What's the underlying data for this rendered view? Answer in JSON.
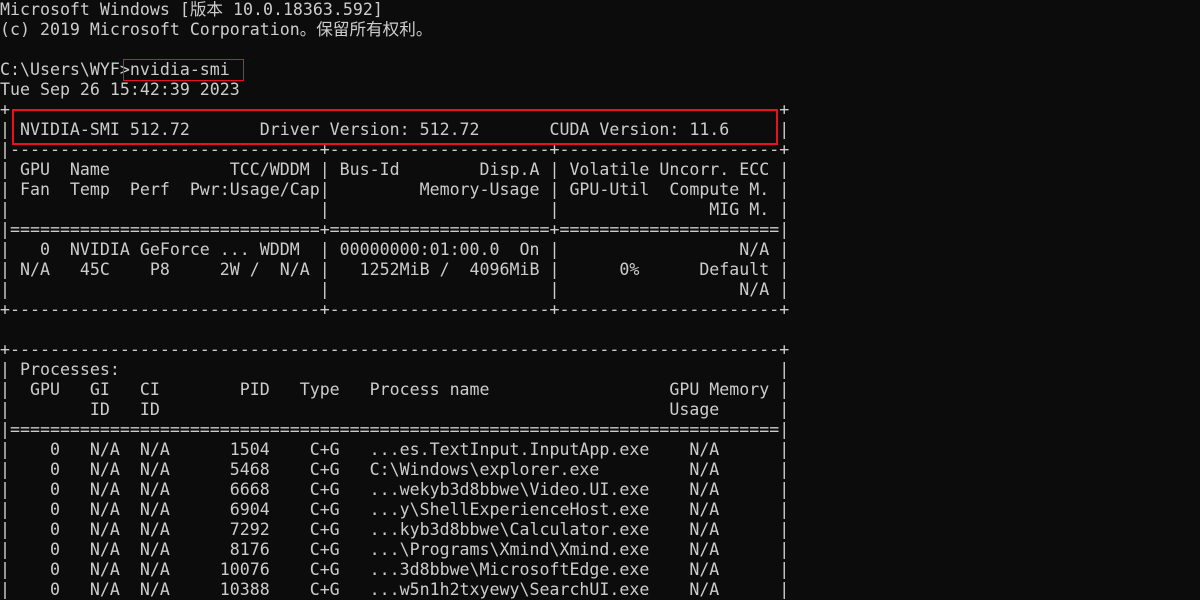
{
  "terminal": {
    "lines": [
      "Microsoft Windows [版本 10.0.18363.592]",
      "(c) 2019 Microsoft Corporation。保留所有权利。",
      "",
      "C:\\Users\\WYF>nvidia-smi",
      "Tue Sep 26 15:42:39 2023",
      "+-----------------------------------------------------------------------------+",
      "| NVIDIA-SMI 512.72       Driver Version: 512.72       CUDA Version: 11.6     |",
      "|-------------------------------+----------------------+----------------------+",
      "| GPU  Name            TCC/WDDM | Bus-Id        Disp.A | Volatile Uncorr. ECC |",
      "| Fan  Temp  Perf  Pwr:Usage/Cap|         Memory-Usage | GPU-Util  Compute M. |",
      "|                               |                      |               MIG M. |",
      "|===============================+======================+======================|",
      "|   0  NVIDIA GeForce ... WDDM  | 00000000:01:00.0  On |                  N/A |",
      "| N/A   45C    P8     2W /  N/A |   1252MiB /  4096MiB |      0%      Default |",
      "|                               |                      |                  N/A |",
      "+-------------------------------+----------------------+----------------------+",
      "",
      "+-----------------------------------------------------------------------------+",
      "| Processes:                                                                  |",
      "|  GPU   GI   CI        PID   Type   Process name                  GPU Memory |",
      "|        ID   ID                                                   Usage      |",
      "|=============================================================================|",
      "|    0   N/A  N/A      1504    C+G   ...es.TextInput.InputApp.exe    N/A      |",
      "|    0   N/A  N/A      5468    C+G   C:\\Windows\\explorer.exe         N/A      |",
      "|    0   N/A  N/A      6668    C+G   ...wekyb3d8bbwe\\Video.UI.exe    N/A      |",
      "|    0   N/A  N/A      6904    C+G   ...y\\ShellExperienceHost.exe    N/A      |",
      "|    0   N/A  N/A      7292    C+G   ...kyb3d8bbwe\\Calculator.exe    N/A      |",
      "|    0   N/A  N/A      8176    C+G   ...\\Programs\\Xmind\\Xmind.exe    N/A      |",
      "|    0   N/A  N/A     10076    C+G   ...3d8bbwe\\MicrosoftEdge.exe    N/A      |",
      "|    0   N/A  N/A     10388    C+G   ...w5n1h2txyewy\\SearchUI.exe    N/A      |"
    ]
  },
  "highlight_color": "#e81123",
  "text_color": "#cccccc",
  "background_color": "#0c0c0c"
}
